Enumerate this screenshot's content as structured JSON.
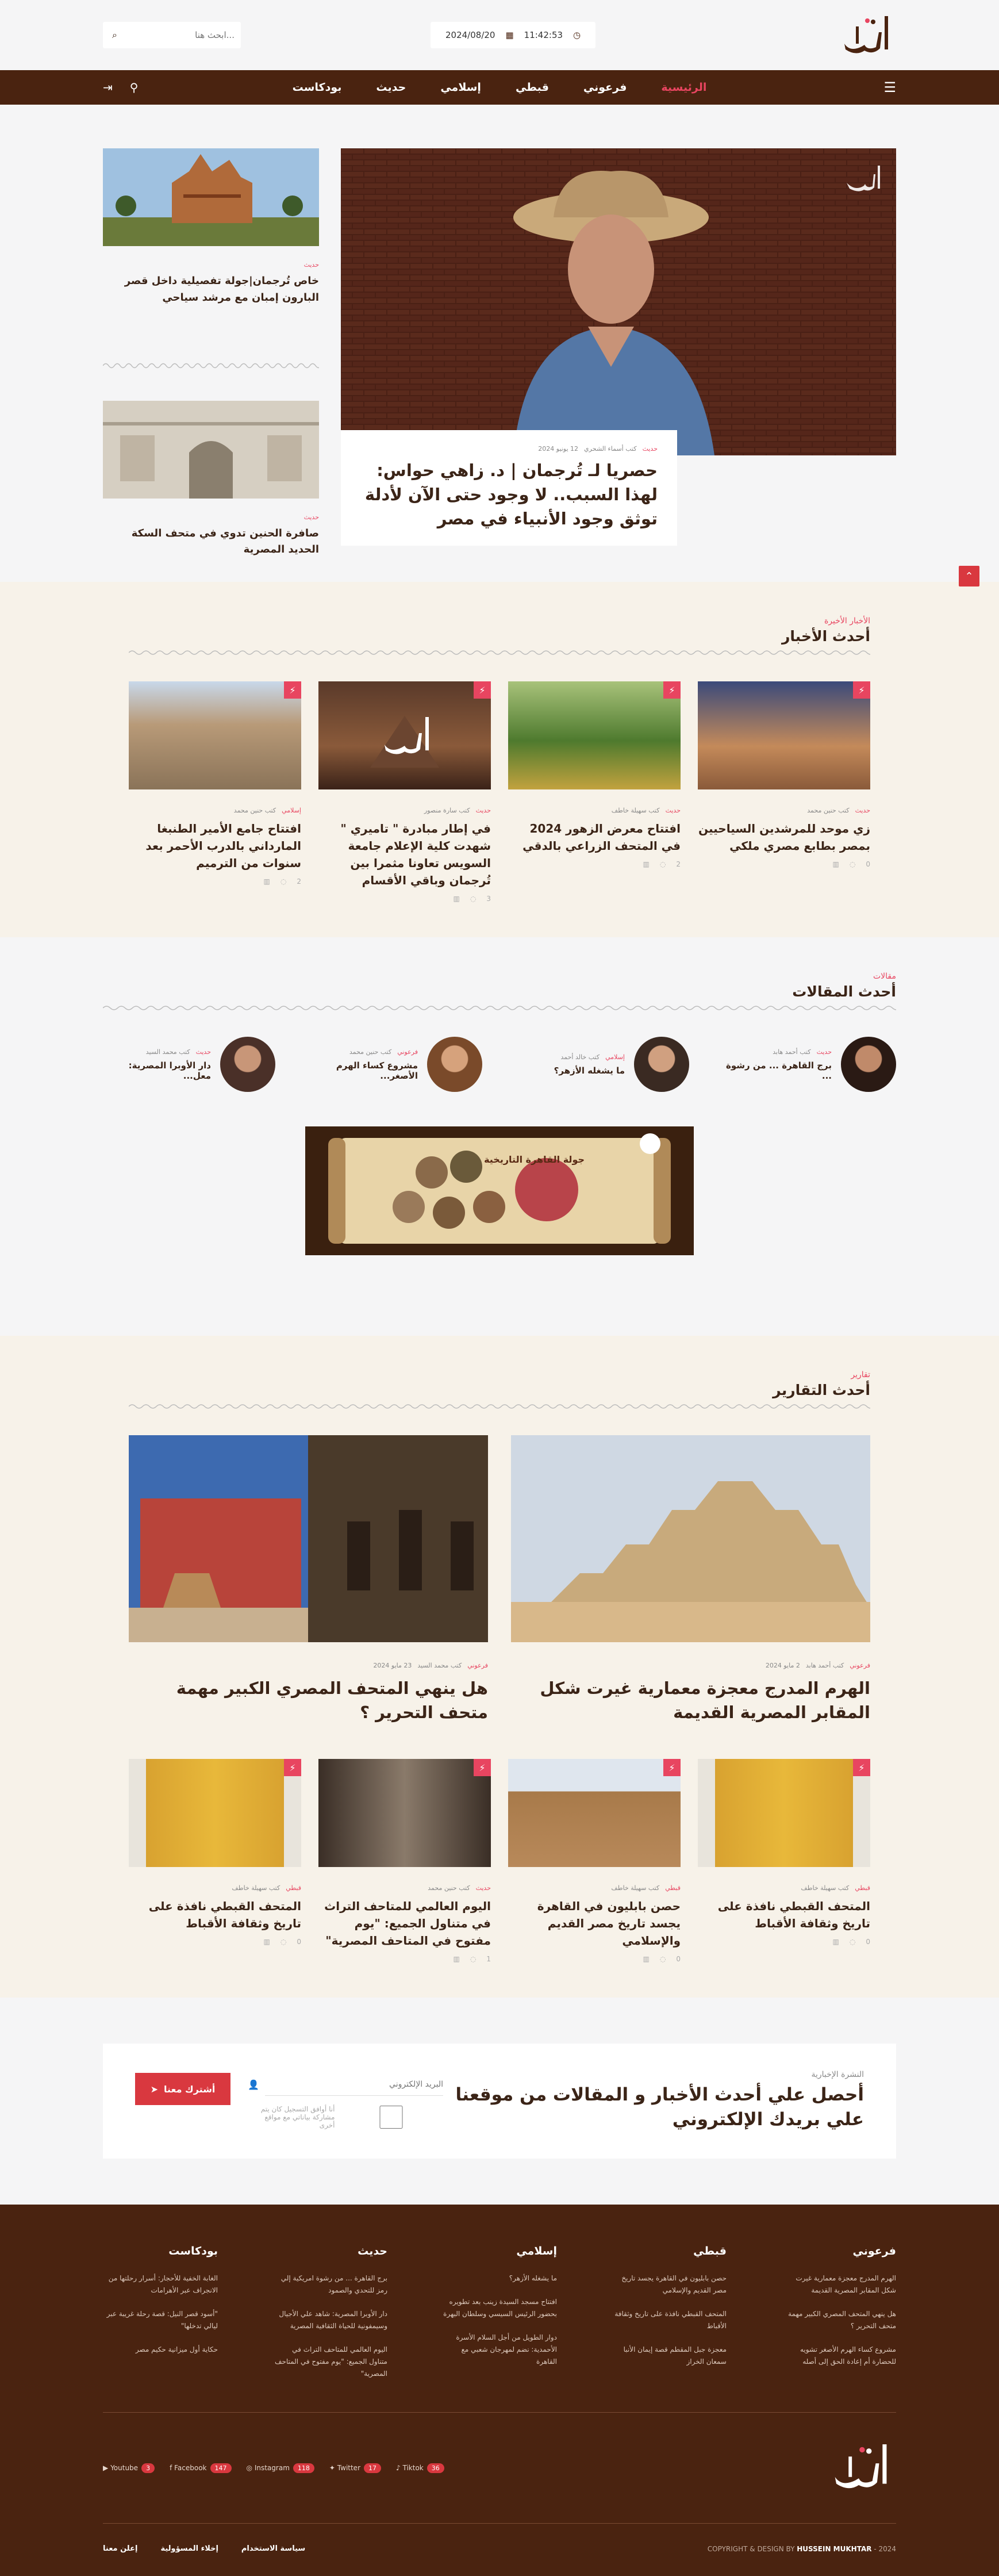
{
  "header": {
    "logo_alt": "ترجمان",
    "time": "11:42:53",
    "date": "2024/08/20",
    "search_placeholder": "ابحث هنا..."
  },
  "nav": {
    "items": [
      "الرئيسية",
      "فرعوني",
      "قبطي",
      "إسلامي",
      "حديث",
      "بودكاست"
    ]
  },
  "hero": {
    "main": {
      "category": "حديث",
      "author": "كتب أسماء الشحري",
      "date": "12 يونيو 2024",
      "title": "حصريا لـ تُرجمان | د. زاهي حواس: لهذا السبب.. لا وجود حتى الآن لأدلة توثق وجود الأنبياء في مصر"
    },
    "side": [
      {
        "category": "حديث",
        "title": "خاص تُرجمان|جولة تفصيلية داخل قصر البارون إمبان مع مرشد سياحي"
      },
      {
        "category": "حديث",
        "title": "صافرة الحنين تدوي في متحف السكة الحديد المصرية"
      }
    ]
  },
  "latest_news": {
    "subtitle": "الأخبار الأخيرة",
    "title": "أحدث الأخبار",
    "items": [
      {
        "category": "حديث",
        "author": "كتب حنين محمد",
        "title": "زي موحد للمرشدين السياحيين بمصر بطابع مصري ملكي",
        "comments": "0",
        "views": ""
      },
      {
        "category": "حديث",
        "author": "كتب سهيلة خاطف",
        "title": "افتتاح معرض الزهور 2024 في المتحف الزراعي بالدقي",
        "comments": "2",
        "views": ""
      },
      {
        "category": "حديث",
        "author": "كتب سارة منصور",
        "title": "في إطار مبادرة \" تاميري \" شهدت كلية الإعلام جامعة السويس تعاونا مثمرا بين تُرجمان وباقي الأقسام",
        "comments": "3",
        "views": ""
      },
      {
        "category": "إسلامي",
        "author": "كتب حنين محمد",
        "title": "افتتاح جامع الأمير الطنبغا المارداني بالدرب الأحمر بعد سنوات من الترميم",
        "comments": "2",
        "views": ""
      }
    ]
  },
  "articles": {
    "subtitle": "مقالات",
    "title": "أحدث المقالات",
    "items": [
      {
        "category": "حديث",
        "author": "كتب أحمد هابد",
        "title": "برج القاهرة ... من رشوة ..."
      },
      {
        "category": "إسلامي",
        "author": "كتب خالد أحمد",
        "title": "ما يشغله الأزهر؟"
      },
      {
        "category": "فرعوني",
        "author": "كتب حنين محمد",
        "title": "مشروع كساء الهرم الأصغر..."
      },
      {
        "category": "حديث",
        "author": "كتب محمد السيد",
        "title": "دار الأوبرا المصرية: معل..."
      }
    ]
  },
  "ad": {
    "title": "جولة القاهرة التاريخية"
  },
  "reports": {
    "subtitle": "تقارير",
    "title": "أحدث التقارير",
    "big": [
      {
        "category": "فرعوني",
        "author": "كتب أحمد هابد",
        "date": "2 مايو 2024",
        "title": "الهرم المدرج معجزة معمارية غيرت شكل المقابر المصرية القديمة"
      },
      {
        "category": "فرعوني",
        "author": "كتب محمد السيد",
        "date": "23 مايو 2024",
        "title": "هل ينهي المتحف المصري الكبير مهمة متحف التحرير ؟"
      }
    ],
    "items": [
      {
        "category": "قبطي",
        "author": "كتب سهيلة خاطف",
        "title": "المتحف القبطي نافذة على تاريخ وثقافة الأقباط",
        "comments": "0"
      },
      {
        "category": "قبطي",
        "author": "كتب سهيلة خاطف",
        "title": "حصن بابليون في القاهرة يجسد تاريخ مصر القديم والإسلامي",
        "comments": "0"
      },
      {
        "category": "حديث",
        "author": "كتب حنين محمد",
        "title": "اليوم العالمي للمتاحف التراث في متناول الجميع: \"يوم مفتوح في المتاحف المصرية\"",
        "comments": "1"
      },
      {
        "category": "قبطي",
        "author": "كتب سهيلة خاطف",
        "title": "المتحف القبطي نافذة على تاريخ وثقافة الأقباط",
        "comments": "0"
      }
    ]
  },
  "newsletter": {
    "small": "النشرة الإخبارية",
    "title": "أحصل علي أحدث الأخبار و المقالات من موقعنا علي بريدك الإلكتروني",
    "email_placeholder": "البريد الإلكتروني",
    "consent": "أنا أوافق التسجيل كان يتم مشاركة بياناتي مع مواقع أخرى",
    "button": "أشترك معنا"
  },
  "footer": {
    "columns": [
      {
        "title": "فرعوني",
        "links": [
          "الهرم المدرج معجزة معمارية غيرت شكل المقابر المصرية القديمة",
          "هل ينهي المتحف المصري الكبير مهمة متحف التحرير ؟",
          "مشروع كساء الهرم الأصغر تشويه للحضارة أم إعادة الحق إلى أصله"
        ]
      },
      {
        "title": "قبطي",
        "links": [
          "حصن بابليون في القاهرة يجسد تاريخ مصر القديم والإسلامي",
          "المتحف القبطي نافذة على تاريخ وثقافة الأقباط",
          "معجزة جبل المقطم قصة إيمان الأنبا سمعان الخراز"
        ]
      },
      {
        "title": "إسلامي",
        "links": [
          "ما يشغله الأزهر؟",
          "افتتاح مسجد السيدة زينب بعد تطويره بحضور الرئيس السيسي وسلطان البهرة",
          "دوار الطويل من أجل السلام الأسرة الأحمدية: نضم لمهرجان شعبي مع القاهرة"
        ]
      },
      {
        "title": "حديث",
        "links": [
          "برج القاهرة ... من رشوة امريكية إلي رمز للتحدي والصمود",
          "دار الأوبرا المصرية: شاهد علي الأجيال وسيمفونية للحياة الثقافية المصرية",
          "اليوم العالمي للمتاحف التراث في متناول الجميع: \"يوم مفتوح في المتاحف المصرية\""
        ]
      },
      {
        "title": "بودكاست",
        "links": [
          "الغابة الخفية للأحجار: أسرار رحلتها من الانجراف عبر الأهرامات",
          "\"أسود قصر النيل: قصة رحلة غريبة عبر ليالي تدخلها\"",
          "حكاية أول ميزانية حكيم مصر"
        ]
      }
    ],
    "socials": [
      {
        "name": "Youtube",
        "count": "3"
      },
      {
        "name": "Facebook",
        "count": "147"
      },
      {
        "name": "Instagram",
        "count": "118"
      },
      {
        "name": "Twitter",
        "count": "17"
      },
      {
        "name": "Tiktok",
        "count": "36"
      }
    ],
    "links": [
      "سياسة الاستخدام",
      "إخلاء المسؤولية",
      "إعلن معنا"
    ],
    "copyright_prefix": "COPYRIGHT & DESIGN BY",
    "copyright_name": "HUSSEIN MUKHTAR",
    "copyright_year": "- 2024"
  },
  "colors": {
    "brown": "#4a2310",
    "accent": "#e84560",
    "cream": "#f7f2e9"
  }
}
